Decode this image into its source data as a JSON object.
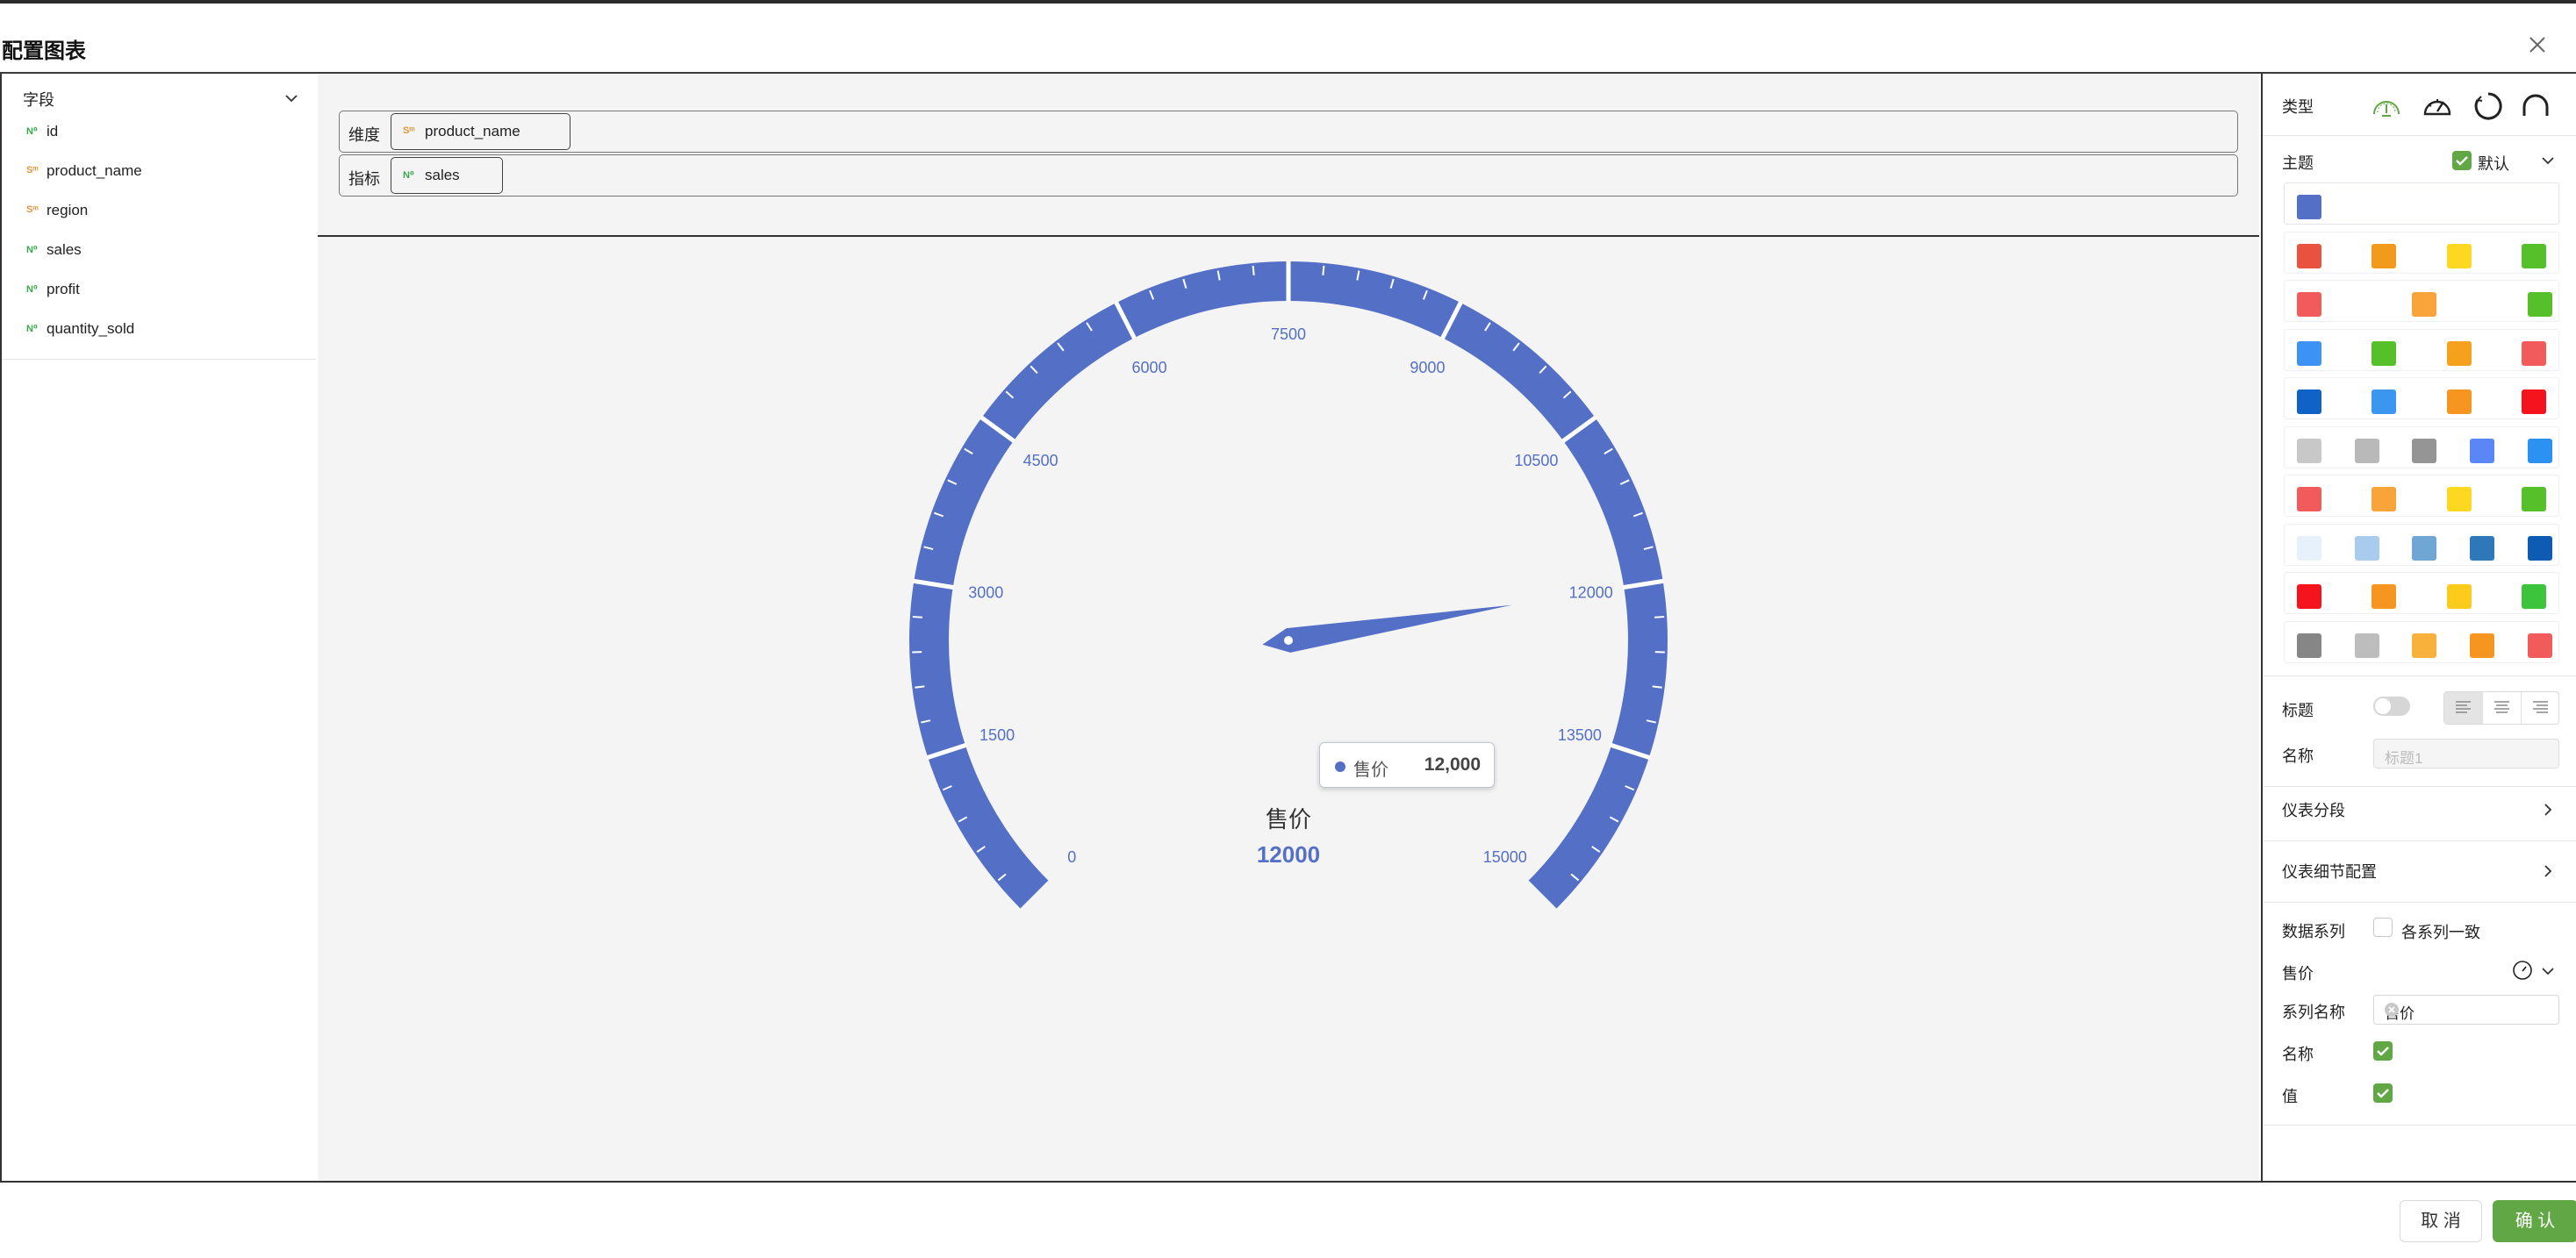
{
  "dialog": {
    "title": "配置图表"
  },
  "fields": {
    "header": "字段",
    "items": [
      {
        "name": "id",
        "type": "num",
        "type_icon": "N⁰"
      },
      {
        "name": "product_name",
        "type": "str",
        "type_icon": "Sᵐ"
      },
      {
        "name": "region",
        "type": "str",
        "type_icon": "Sᵐ"
      },
      {
        "name": "sales",
        "type": "num",
        "type_icon": "N⁰"
      },
      {
        "name": "profit",
        "type": "num",
        "type_icon": "N⁰"
      },
      {
        "name": "quantity_sold",
        "type": "num",
        "type_icon": "N⁰"
      }
    ]
  },
  "config": {
    "dimension_label": "维度",
    "dimension_chip": {
      "name": "product_name",
      "type_icon": "Sᵐ"
    },
    "measure_label": "指标",
    "measure_chip": {
      "name": "sales",
      "type_icon": "N⁰"
    }
  },
  "chart_data": {
    "type": "gauge",
    "min": 0,
    "max": 15000,
    "value": 12000,
    "tick_labels": [
      "0",
      "1500",
      "3000",
      "4500",
      "6000",
      "7500",
      "9000",
      "10500",
      "12000",
      "13500",
      "15000"
    ],
    "series_name": "售价",
    "value_label": "12000",
    "color": "#5470c6"
  },
  "tooltip": {
    "label": "售价",
    "value": "12,000"
  },
  "right_panel": {
    "type_label": "类型",
    "type_icons": [
      "gauge-green-icon",
      "speedometer-icon",
      "ring-progress-icon",
      "arc-gauge-icon"
    ],
    "theme_label": "主题",
    "theme_default_label": "默认",
    "palettes": [
      [
        "#5470c6"
      ],
      [
        "#e8523f",
        "#f29a1c",
        "#fcd920",
        "#56c02b"
      ],
      [
        "#f25b5b",
        "",
        "#f8a43a",
        "",
        "#56c02b"
      ],
      [
        "#3d93f5",
        "#56c02b",
        "#f6a11e",
        "#f25b5b"
      ],
      [
        "#1062c6",
        "#3a96ef",
        "#f6951f",
        "#f5141e"
      ],
      [
        "#c8c8c8",
        "#b9b9b9",
        "#959595",
        "#5b86f5",
        "#2b92f1"
      ],
      [
        "#f25b5b",
        "#f8a43a",
        "#fcd920",
        "#56c02b"
      ],
      [
        "#e6f1fc",
        "#a8cbee",
        "#6fa6d3",
        "#2e78ba",
        "#0e5bb3"
      ],
      [
        "#f5141e",
        "#f6951f",
        "#fccb1b",
        "#3cc43c"
      ],
      [
        "#868686",
        "#bdbdbd",
        "#f8b23c",
        "#f6951f",
        "#f25b5b"
      ]
    ],
    "title_label": "标题",
    "name_label": "名称",
    "name_placeholder": "标题1",
    "gauge_segment_label": "仪表分段",
    "gauge_detail_label": "仪表细节配置",
    "data_series_label": "数据系列",
    "series_consistent_label": "各系列一致",
    "series_item_label": "售价",
    "series_name_label": "系列名称",
    "series_name_value": "售价",
    "show_name_label": "名称",
    "show_value_label": "值"
  },
  "footer": {
    "cancel_label": "取 消",
    "confirm_label": "确 认"
  }
}
